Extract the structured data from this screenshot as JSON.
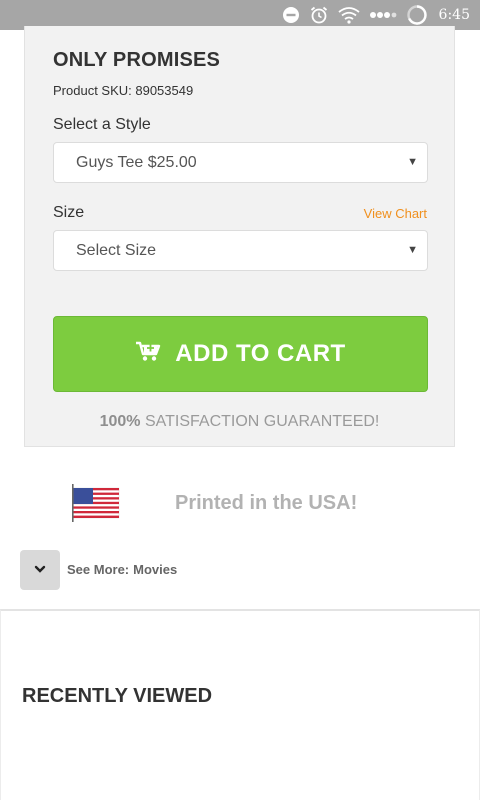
{
  "status_bar": {
    "time": "6:45",
    "icons": [
      "do-not-disturb-icon",
      "alarm-icon",
      "wifi-icon",
      "signal-dots-icon",
      "battery-loading-icon"
    ]
  },
  "product": {
    "title": "ONLY PROMISES",
    "sku": "Product SKU: 89053549",
    "style_label": "Select a Style",
    "style_selected": "Guys Tee $25.00",
    "size_label": "Size",
    "view_chart": "View Chart",
    "size_selected": "Select Size",
    "cart_label": "ADD TO CART",
    "guarantee_bold": "100%",
    "guarantee_text": " SATISFACTION GUARANTEED!"
  },
  "usa": {
    "text": "Printed in the USA!"
  },
  "see_more": {
    "label": "See More:",
    "link": "Movies"
  },
  "recently_viewed": {
    "title": "RECENTLY VIEWED"
  },
  "colors": {
    "accent_green": "#7dcc3f",
    "link_orange": "#f0901e",
    "status_bar": "#a6a6a6"
  }
}
